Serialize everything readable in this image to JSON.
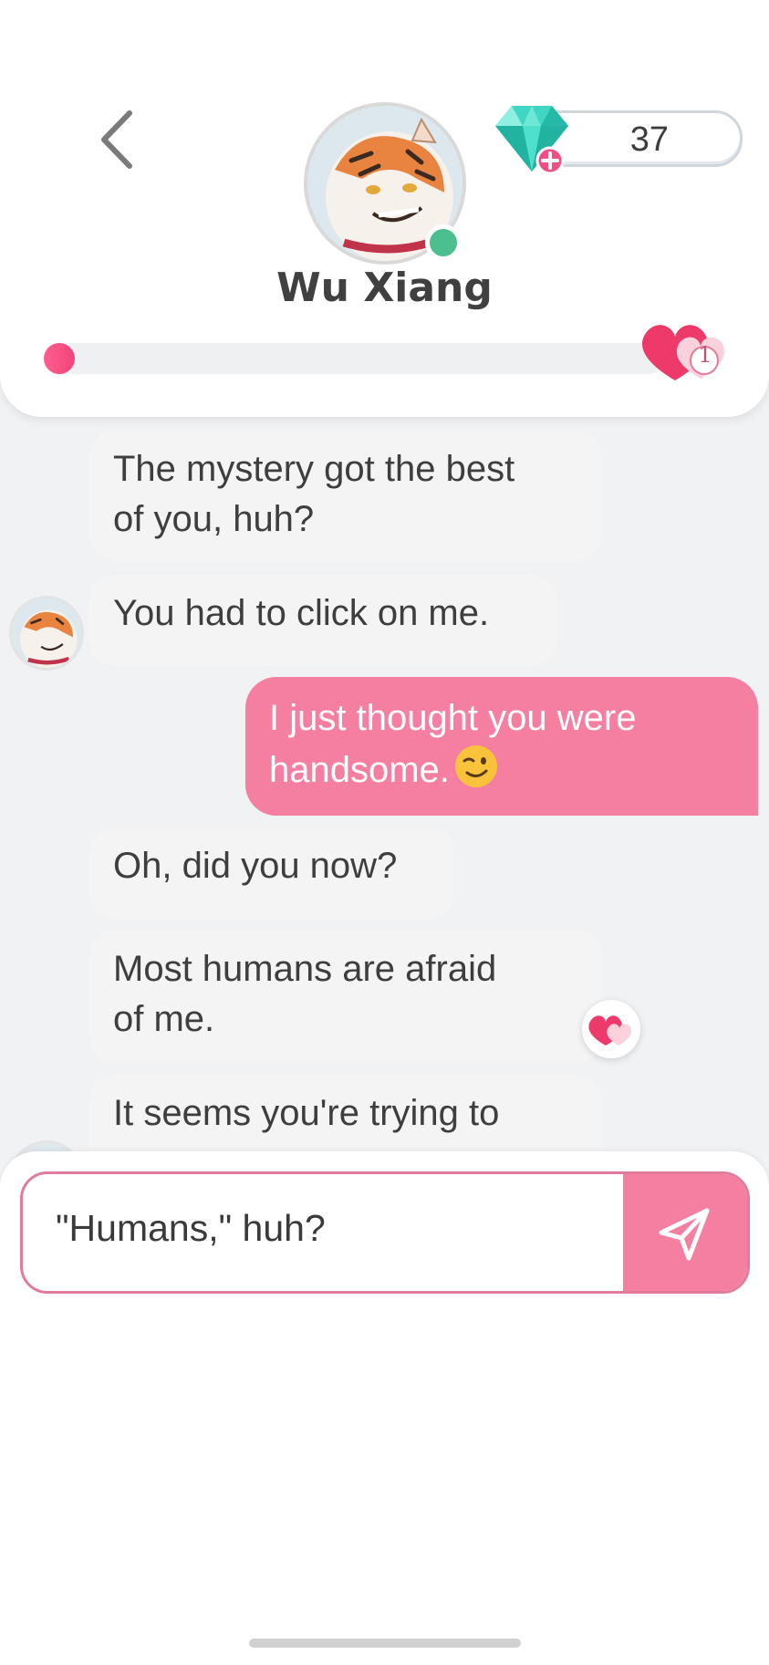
{
  "header": {
    "contact_name": "Wu Xiang",
    "gem_count": "37",
    "relationship_progress": 0.04,
    "hearts_level": "1",
    "online": true
  },
  "messages": [
    {
      "from": "contact",
      "text_lines": [
        "The mystery got the best",
        "of you, huh?"
      ]
    },
    {
      "from": "contact",
      "text_lines": [
        "You had to click on me."
      ]
    },
    {
      "from": "user",
      "text_lines": [
        "I just thought you were",
        "handsome."
      ],
      "emoji": "winking-face"
    },
    {
      "from": "contact",
      "text_lines": [
        "Oh, did you now?"
      ]
    },
    {
      "from": "contact",
      "text_lines": [
        "Most humans are afraid",
        "of me."
      ],
      "reaction": "hearts"
    },
    {
      "from": "contact",
      "text_lines": [
        "It seems you're trying to"
      ]
    }
  ],
  "composer": {
    "value": "\"Humans,\" huh?"
  },
  "colors": {
    "accent_pink": "#f47fa0",
    "online_green": "#4cbf8f",
    "bubble_grey": "#f4f4f4"
  }
}
